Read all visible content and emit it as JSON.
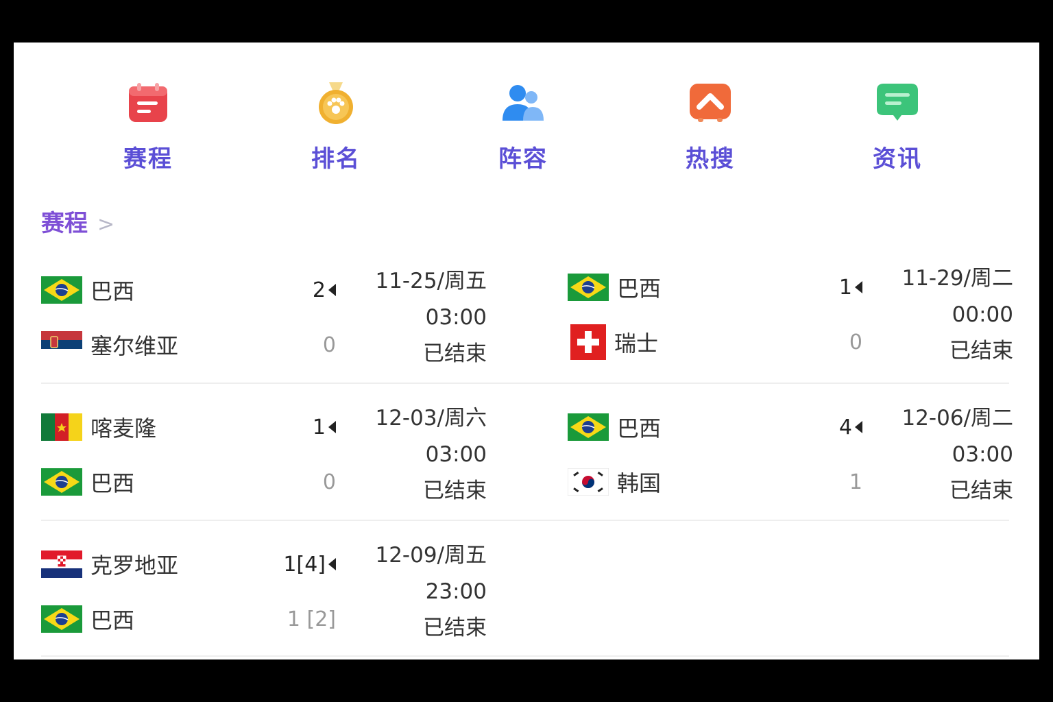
{
  "nav": {
    "items": [
      {
        "label": "赛程",
        "icon": "calendar-icon",
        "color": "#e8434b"
      },
      {
        "label": "排名",
        "icon": "medal-icon",
        "color": "#f0b030"
      },
      {
        "label": "阵容",
        "icon": "people-icon",
        "color": "#2f8cf0"
      },
      {
        "label": "热搜",
        "icon": "hot-search-icon",
        "color": "#f06a3a"
      },
      {
        "label": "资讯",
        "icon": "message-icon",
        "color": "#3cc47a"
      }
    ]
  },
  "section": {
    "title": "赛程"
  },
  "matches": [
    {
      "team1": "巴西",
      "flag1": "brazil",
      "score1": "2",
      "team2": "塞尔维亚",
      "flag2": "serbia",
      "score2": "0",
      "date": "11-25/周五",
      "time": "03:00",
      "status": "已结束"
    },
    {
      "team1": "巴西",
      "flag1": "brazil",
      "score1": "1",
      "team2": "瑞士",
      "flag2": "switzerland",
      "score2": "0",
      "date": "11-29/周二",
      "time": "00:00",
      "status": "已结束"
    },
    {
      "team1": "喀麦隆",
      "flag1": "cameroon",
      "score1": "1",
      "team2": "巴西",
      "flag2": "brazil",
      "score2": "0",
      "date": "12-03/周六",
      "time": "03:00",
      "status": "已结束"
    },
    {
      "team1": "巴西",
      "flag1": "brazil",
      "score1": "4",
      "team2": "韩国",
      "flag2": "korea",
      "score2": "1",
      "date": "12-06/周二",
      "time": "03:00",
      "status": "已结束"
    },
    {
      "team1": "克罗地亚",
      "flag1": "croatia",
      "score1": "1[4]",
      "team2": "巴西",
      "flag2": "brazil",
      "score2": "1 [2]",
      "date": "12-09/周五",
      "time": "23:00",
      "status": "已结束"
    }
  ]
}
